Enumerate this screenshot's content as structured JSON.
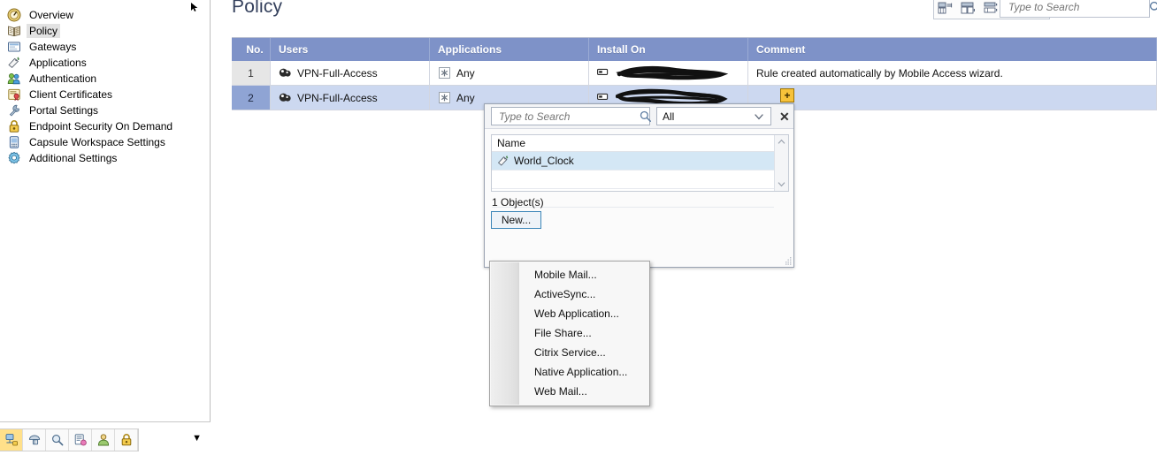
{
  "sidebar": {
    "scroll_arrow_icon": "cursor-arrow-icon",
    "items": [
      {
        "label": "Overview",
        "icon": "overview-icon",
        "selected": false
      },
      {
        "label": "Policy",
        "icon": "policy-book-icon",
        "selected": true
      },
      {
        "label": "Gateways",
        "icon": "gateways-icon",
        "selected": false
      },
      {
        "label": "Applications",
        "icon": "applications-tag-icon",
        "selected": false
      },
      {
        "label": "Authentication",
        "icon": "authentication-users-icon",
        "selected": false
      },
      {
        "label": "Client Certificates",
        "icon": "certificate-icon",
        "selected": false
      },
      {
        "label": "Portal Settings",
        "icon": "wrench-icon",
        "selected": false
      },
      {
        "label": "Endpoint Security On Demand",
        "icon": "padlock-icon",
        "selected": false
      },
      {
        "label": "Capsule Workspace Settings",
        "icon": "mobile-device-icon",
        "selected": false
      },
      {
        "label": "Additional Settings",
        "icon": "gear-icon",
        "selected": false
      }
    ],
    "bottom_toolbar": {
      "buttons": [
        {
          "icon": "network-object-icon",
          "active": true
        },
        {
          "icon": "vpn-tunnel-icon",
          "active": false
        },
        {
          "icon": "search-object-icon",
          "active": false
        },
        {
          "icon": "server-settings-icon",
          "active": false
        },
        {
          "icon": "users-icon",
          "active": false
        },
        {
          "icon": "padlock-icon",
          "active": false
        }
      ],
      "expand_icon": "chevron-down-icon"
    }
  },
  "main": {
    "title": "Policy",
    "view_tools": [
      {
        "icon": "table-layout-grid-icon"
      },
      {
        "icon": "table-layout-rows-icon"
      },
      {
        "icon": "table-layout-split-icon"
      },
      {
        "icon": "table-layout-compact-icon"
      },
      {
        "icon": "clear-filter-icon"
      }
    ],
    "search": {
      "placeholder": "Type to Search",
      "value": "",
      "icon": "search-icon"
    },
    "table": {
      "columns": [
        "No.",
        "Users",
        "Applications",
        "Install On",
        "Comment"
      ],
      "rows": [
        {
          "no": "1",
          "users": "VPN-Full-Access",
          "users_icon": "user-group-icon",
          "applications": "Any",
          "applications_icon": "any-asterisk-icon",
          "install_on": "",
          "install_on_icon": "gateway-icon",
          "install_on_redacted": true,
          "comment": "Rule created automatically by Mobile Access wizard.",
          "selected": false
        },
        {
          "no": "2",
          "users": "VPN-Full-Access",
          "users_icon": "user-group-icon",
          "applications": "Any",
          "applications_icon": "any-asterisk-icon",
          "install_on": "",
          "install_on_icon": "gateway-icon",
          "install_on_redacted": true,
          "comment": "",
          "selected": true
        }
      ]
    },
    "add_badge": {
      "label": "+",
      "icon": "add-plus-icon",
      "color": "#f7c23a"
    }
  },
  "picker": {
    "search": {
      "placeholder": "Type to Search",
      "value": "",
      "icon": "search-icon"
    },
    "filter": {
      "value": "All",
      "icon": "chevron-down-icon"
    },
    "close": {
      "label": "✕",
      "icon": "close-icon"
    },
    "list": {
      "header": "Name",
      "rows": [
        {
          "label": "World_Clock",
          "icon": "application-tag-icon",
          "selected": true
        },
        {
          "label": "",
          "icon": "",
          "selected": false
        },
        {
          "label": "",
          "icon": "",
          "selected": false
        }
      ],
      "scroll_up_icon": "chevron-up-icon",
      "scroll_down_icon": "chevron-down-icon"
    },
    "object_count": "1 Object(s)",
    "new_button": "New...",
    "resize_grip_icon": "resize-grip-icon"
  },
  "context_menu": {
    "items": [
      {
        "label": "Mobile Mail..."
      },
      {
        "label": "ActiveSync..."
      },
      {
        "label": "Web Application..."
      },
      {
        "label": "File Share..."
      },
      {
        "label": "Citrix Service..."
      },
      {
        "label": "Native Application..."
      },
      {
        "label": "Web Mail..."
      }
    ]
  },
  "colors": {
    "header_blue": "#7e92c8",
    "selected_row": "#ccd8f0",
    "title_navy": "#34405c",
    "accent_yellow": "#f7c23a",
    "list_selection": "#d4e7f5"
  }
}
